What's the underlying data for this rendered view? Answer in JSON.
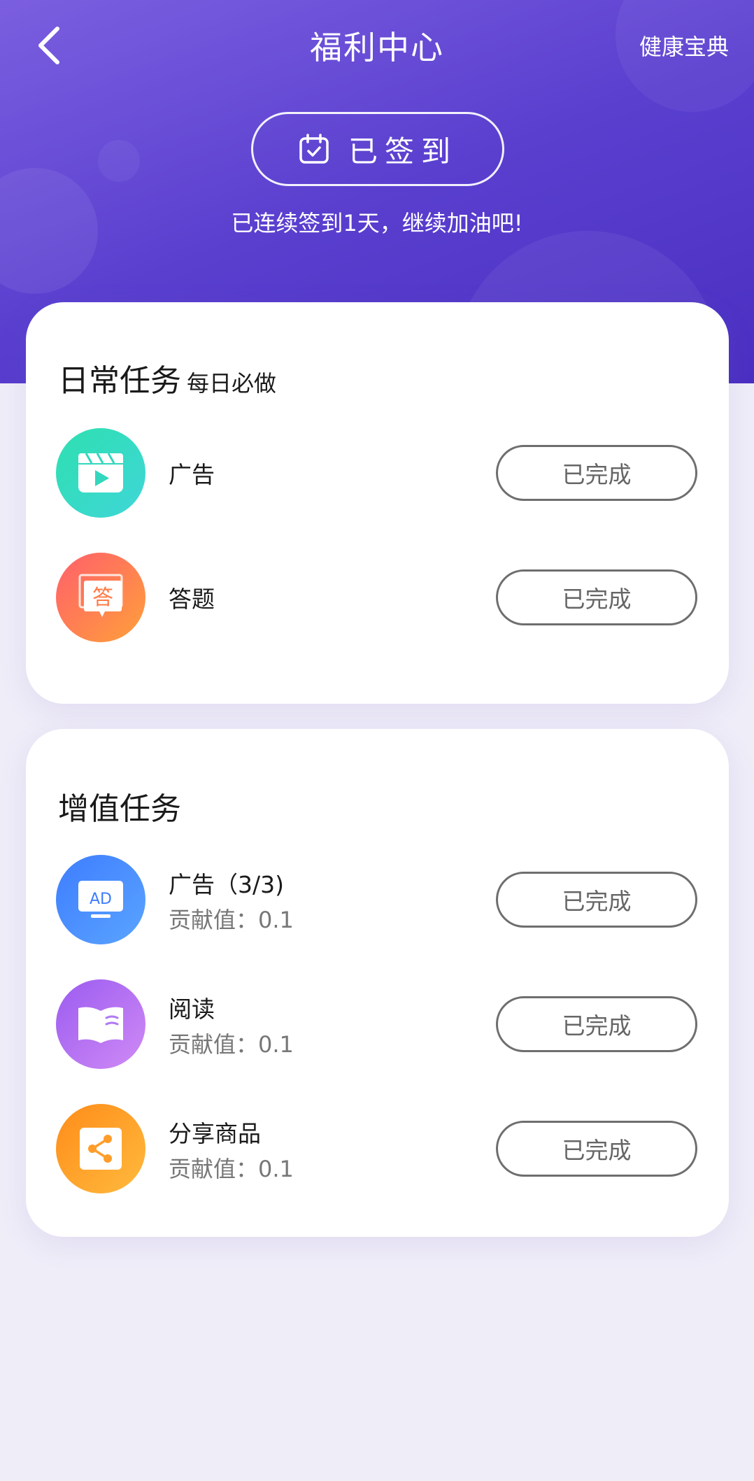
{
  "header": {
    "title": "福利中心",
    "link_label": "健康宝典",
    "checkin_label": "已签到",
    "streak_text": "已连续签到1天，继续加油吧!"
  },
  "daily": {
    "title": "日常任务",
    "subtitle": "每日必做",
    "tasks": [
      {
        "name": "广告",
        "button": "已完成",
        "icon": "video-icon"
      },
      {
        "name": "答题",
        "button": "已完成",
        "icon": "quiz-icon",
        "icon_text": "答"
      }
    ]
  },
  "value_added": {
    "title": "增值任务",
    "tasks": [
      {
        "name": "广告（3/3)",
        "sub": "贡献值：0.1",
        "button": "已完成",
        "icon": "ad-tv-icon",
        "icon_text": "AD",
        "progress_done": 3,
        "progress_total": 3
      },
      {
        "name": "阅读",
        "sub": "贡献值：0.1",
        "button": "已完成",
        "icon": "book-icon"
      },
      {
        "name": "分享商品",
        "sub": "贡献值：0.1",
        "button": "已完成",
        "icon": "share-icon"
      }
    ]
  },
  "colors": {
    "header_gradient_start": "#7b5fe0",
    "header_gradient_end": "#4a2fc2",
    "page_background": "#efedf8",
    "button_border": "#6e6e6e"
  }
}
